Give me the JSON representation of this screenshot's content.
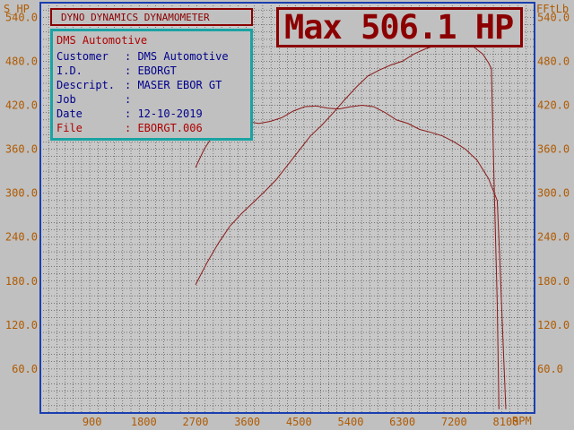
{
  "chart_data": {
    "type": "line",
    "y_left_label": "S_HP",
    "y_right_label": "FFtLb",
    "x_unit_label": "RPM",
    "x_ticks": [
      900,
      1800,
      2700,
      3600,
      4500,
      5400,
      6300,
      7200,
      8100
    ],
    "y_ticks": [
      60.0,
      120.0,
      180.0,
      240.0,
      300.0,
      360.0,
      420.0,
      480.0,
      540.0
    ],
    "y_tick_labels": [
      "60.0",
      "120.0",
      "180.0",
      "240.0",
      "300.0",
      "360.0",
      "420.0",
      "480.0",
      "540.0"
    ],
    "xlim": [
      0,
      8600
    ],
    "ylim": [
      0,
      560
    ],
    "grid": true,
    "series": [
      {
        "color": "#8b1a1a",
        "x": [
          2700,
          2900,
          3100,
          3300,
          3500,
          3700,
          3900,
          4100,
          4300,
          4500,
          4700,
          4900,
          5100,
          5300,
          5500,
          5700,
          5900,
          6100,
          6300,
          6500,
          6700,
          6900,
          7100,
          7300,
          7500,
          7700,
          7800,
          7850,
          7900,
          7950,
          7980
        ],
        "y": [
          175,
          205,
          232,
          255,
          272,
          287,
          302,
          318,
          338,
          358,
          378,
          393,
          410,
          428,
          445,
          460,
          468,
          475,
          480,
          490,
          497,
          502,
          505,
          506.1,
          502,
          490,
          478,
          470,
          300,
          150,
          5
        ]
      },
      {
        "color": "#8b1a1a",
        "x": [
          2700,
          2850,
          3000,
          3200,
          3400,
          3600,
          3800,
          4000,
          4200,
          4400,
          4600,
          4800,
          5000,
          5200,
          5400,
          5600,
          5800,
          6000,
          6200,
          6400,
          6600,
          6800,
          7000,
          7200,
          7400,
          7600,
          7800,
          7950,
          8000,
          8050,
          8100
        ],
        "y": [
          335,
          360,
          378,
          392,
          398,
          398,
          395,
          398,
          403,
          412,
          418,
          419,
          416,
          415,
          418,
          420,
          418,
          410,
          400,
          395,
          387,
          383,
          378,
          370,
          360,
          345,
          320,
          290,
          200,
          100,
          5
        ]
      }
    ]
  },
  "header": {
    "title": "DYNO DYNAMICS DYNAMOMETER"
  },
  "max": {
    "text": "Max 506.1 HP"
  },
  "info": {
    "company": "DMS Automotive",
    "rows": [
      {
        "key": "Customer",
        "value": ": DMS Automotive"
      },
      {
        "key": "I.D.",
        "value": ": EBORGT"
      },
      {
        "key": "Descript.",
        "value": ": MASER EBOR GT"
      },
      {
        "key": "Job",
        "value": ":"
      },
      {
        "key": "Date",
        "value": ": 12-10-2019"
      },
      {
        "key": "File",
        "value": ": EBORGT.006"
      }
    ]
  },
  "colors": {
    "axis_text": "#b05a00",
    "grid": "#202020",
    "frame": "#1a3fb0",
    "curve": "#8b1a1a"
  }
}
